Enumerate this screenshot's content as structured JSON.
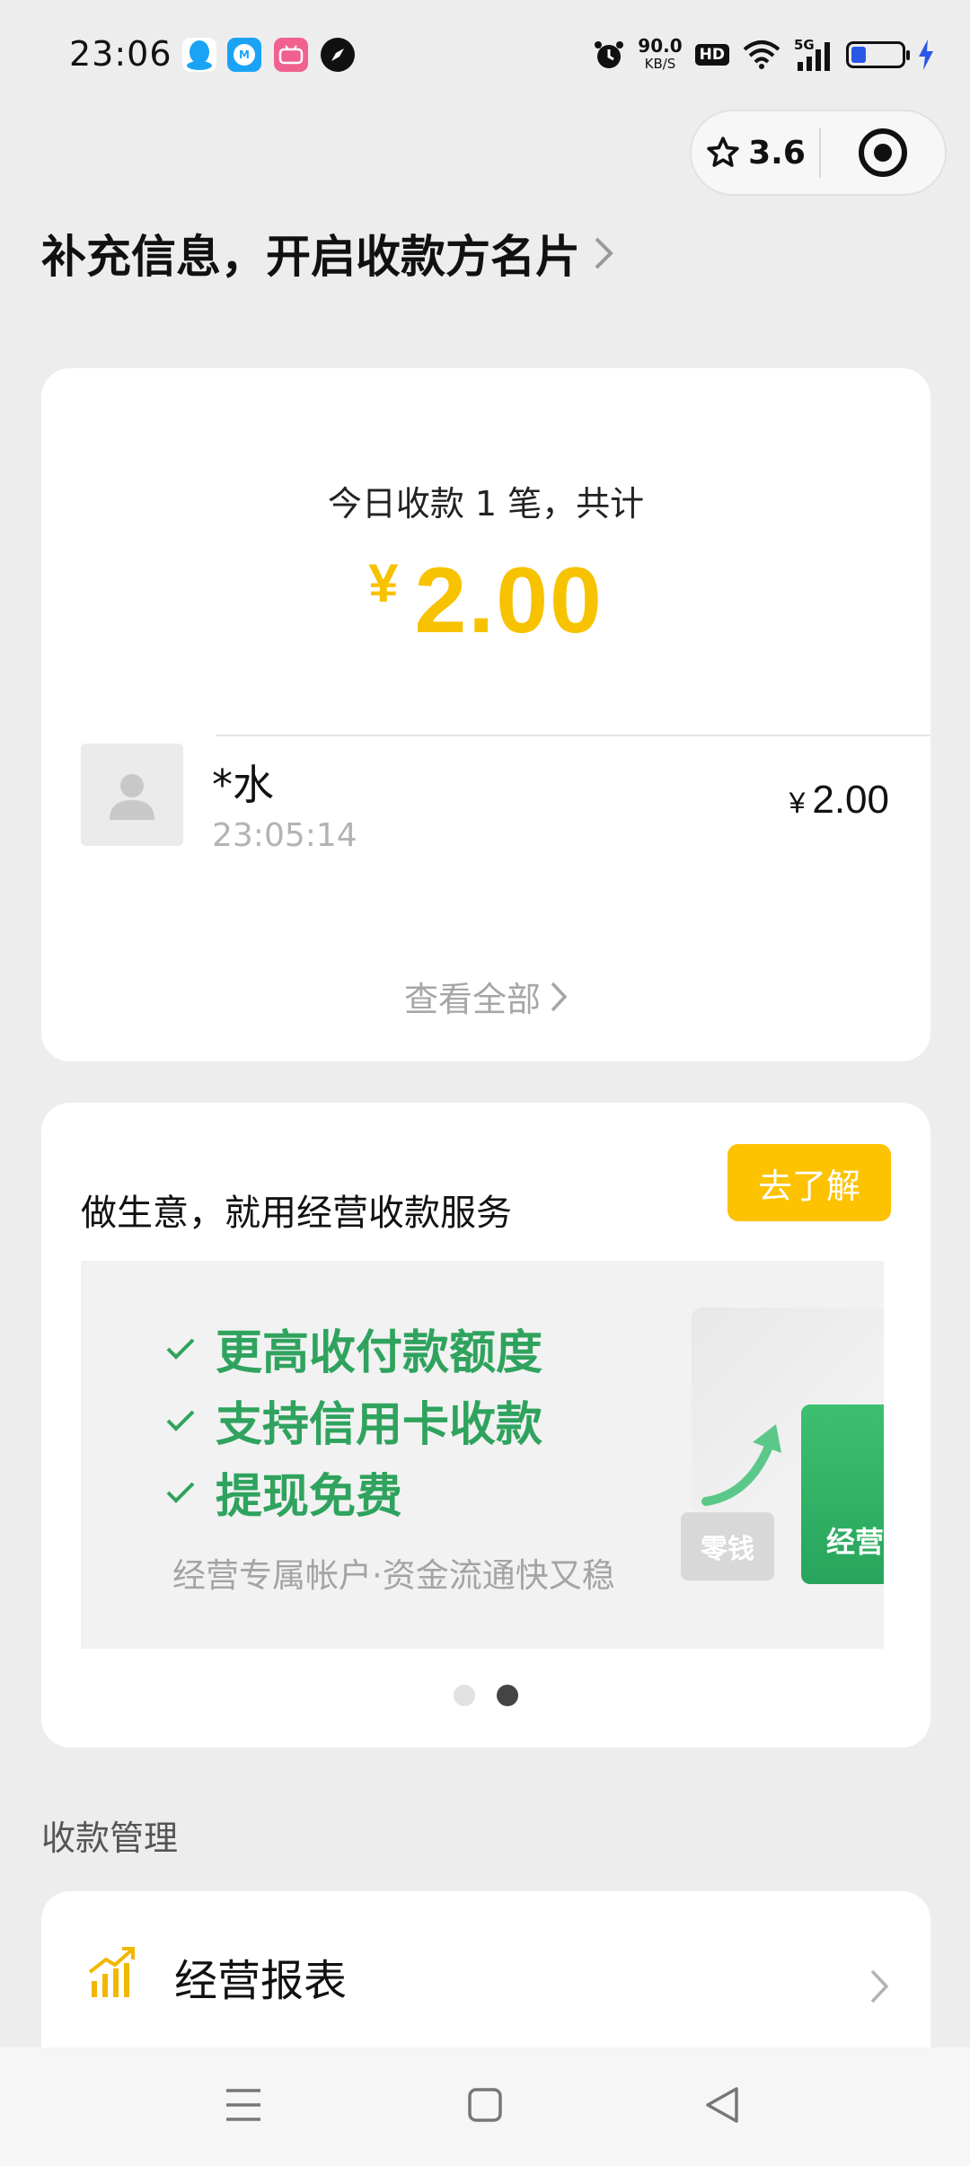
{
  "status_bar": {
    "time": "23:06",
    "net_speed_value": "90.0",
    "net_speed_unit": "KB/S",
    "hd_label": "HD",
    "signal_label": "5G",
    "notif_icons": [
      "qq-icon",
      "mai-app-icon",
      "bilibili-icon",
      "compass-icon"
    ]
  },
  "capsule": {
    "rating": "3.6"
  },
  "header": {
    "link_text": "补充信息，开启收款方名片"
  },
  "summary": {
    "text": "今日收款 1 笔，共计",
    "currency": "¥",
    "total": "2.00"
  },
  "transactions": [
    {
      "name": "*水",
      "time": "23:05:14",
      "currency": "¥",
      "amount": "2.00"
    }
  ],
  "view_all_label": "查看全部",
  "promo": {
    "title": "做生意，就用经营收款服务",
    "button_label": "去了解",
    "features": [
      "更高收付款额度",
      "支持信用卡收款",
      "提现免费"
    ],
    "subtitle": "经营专属帐户·资金流通快又稳",
    "chip_change": "零钱",
    "chip_business": "经营",
    "page_count": 2,
    "active_page": 2
  },
  "section": {
    "label": "收款管理"
  },
  "menu": [
    {
      "label": "经营报表"
    }
  ],
  "colors": {
    "accent_yellow": "#fdc200",
    "amount_yellow": "#f7c200",
    "promo_green": "#2fa35e",
    "background": "#ededed"
  }
}
